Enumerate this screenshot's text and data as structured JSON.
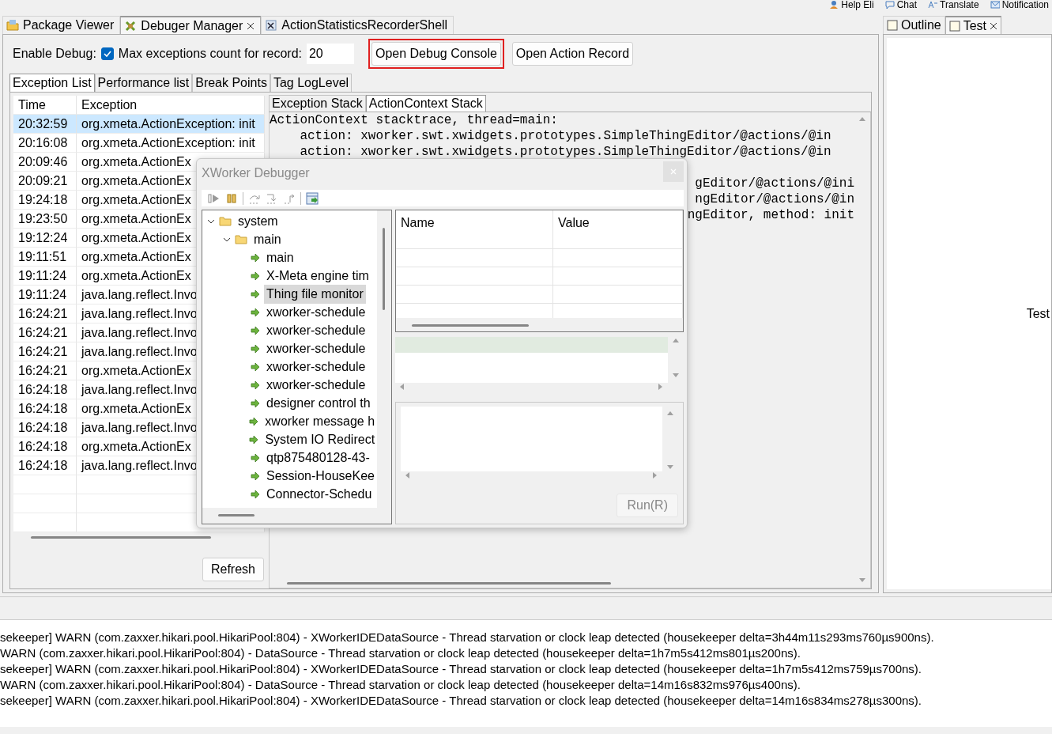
{
  "top_toolbar": [
    {
      "label": "Help Eli"
    },
    {
      "label": "Chat"
    },
    {
      "label": "Translate"
    },
    {
      "label": "Notification"
    }
  ],
  "editor_tabs": [
    {
      "label": "Package Viewer",
      "selected": false,
      "closable": false
    },
    {
      "label": "Debuger Manager",
      "selected": true,
      "closable": true
    },
    {
      "label": "ActionStatisticsRecorderShell",
      "selected": false,
      "closable": false
    }
  ],
  "toolbar": {
    "enable_label": "Enable Debug:",
    "enable_debug": true,
    "max_label": "Max exceptions count for record:",
    "max_value": "20",
    "buttons": [
      {
        "label": "Open Debug Console",
        "highlighted": true
      },
      {
        "label": "Open Action Record",
        "highlighted": false
      }
    ]
  },
  "sub_tabs": [
    {
      "label": "Exception List",
      "selected": true
    },
    {
      "label": "Performance list",
      "selected": false
    },
    {
      "label": "Break Points",
      "selected": false
    },
    {
      "label": "Tag LogLevel",
      "selected": false
    }
  ],
  "exception_table": {
    "columns": [
      "Time",
      "Exception"
    ],
    "rows": [
      {
        "time": "20:32:59",
        "exception": "org.xmeta.ActionException: init",
        "selected": true
      },
      {
        "time": "20:16:08",
        "exception": "org.xmeta.ActionException: init",
        "selected": false
      },
      {
        "time": "20:09:46",
        "exception": "org.xmeta.ActionEx",
        "selected": false
      },
      {
        "time": "20:09:21",
        "exception": "org.xmeta.ActionEx",
        "selected": false
      },
      {
        "time": "19:24:18",
        "exception": "org.xmeta.ActionEx",
        "selected": false
      },
      {
        "time": "19:23:50",
        "exception": "org.xmeta.ActionEx",
        "selected": false
      },
      {
        "time": "19:12:24",
        "exception": "org.xmeta.ActionEx",
        "selected": false
      },
      {
        "time": "19:11:51",
        "exception": "org.xmeta.ActionEx",
        "selected": false
      },
      {
        "time": "19:11:24",
        "exception": "org.xmeta.ActionEx",
        "selected": false
      },
      {
        "time": "19:11:24",
        "exception": "java.lang.reflect.Invo",
        "selected": false
      },
      {
        "time": "16:24:21",
        "exception": "java.lang.reflect.Invo",
        "selected": false
      },
      {
        "time": "16:24:21",
        "exception": "java.lang.reflect.Invo",
        "selected": false
      },
      {
        "time": "16:24:21",
        "exception": "java.lang.reflect.Invo",
        "selected": false
      },
      {
        "time": "16:24:21",
        "exception": "org.xmeta.ActionEx",
        "selected": false
      },
      {
        "time": "16:24:18",
        "exception": "java.lang.reflect.Invo",
        "selected": false
      },
      {
        "time": "16:24:18",
        "exception": "org.xmeta.ActionEx",
        "selected": false
      },
      {
        "time": "16:24:18",
        "exception": "java.lang.reflect.Invo",
        "selected": false
      },
      {
        "time": "16:24:18",
        "exception": "org.xmeta.ActionEx",
        "selected": false
      },
      {
        "time": "16:24:18",
        "exception": "java.lang.reflect.Invo",
        "selected": false
      }
    ]
  },
  "refresh_button": "Refresh",
  "stack_tabs": [
    {
      "label": "Exception Stack",
      "selected": false
    },
    {
      "label": "ActionContext Stack",
      "selected": true
    }
  ],
  "stack_lines": [
    {
      "kind": "line",
      "text": "ActionContext stacktrace, thread=main:"
    },
    {
      "kind": "line",
      "text": "    action: xworker.swt.xwidgets.prototypes.SimpleThingEditor/@actions/@in"
    },
    {
      "kind": "line",
      "text": "    action: xworker.swt.xwidgets.prototypes.SimpleThingEditor/@actions/@in"
    },
    {
      "kind": "gap"
    },
    {
      "kind": "tail",
      "text": "gEditor/@actions/@ini"
    },
    {
      "kind": "tail",
      "text": "ngEditor/@actions/@in"
    },
    {
      "kind": "tail",
      "text": "ngEditor, method: init"
    }
  ],
  "debugger_dialog": {
    "title": "XWorker Debugger",
    "active": false,
    "tree": [
      {
        "label": "system",
        "expanded": true,
        "children": [
          {
            "label": "main",
            "expanded": true,
            "children": [
              {
                "label": "main",
                "selected": false
              },
              {
                "label": "X-Meta engine tim",
                "selected": false
              },
              {
                "label": "Thing file monitor",
                "selected": true
              },
              {
                "label": "xworker-schedule",
                "selected": false
              },
              {
                "label": "xworker-schedule",
                "selected": false
              },
              {
                "label": "xworker-schedule",
                "selected": false
              },
              {
                "label": "xworker-schedule",
                "selected": false
              },
              {
                "label": "xworker-schedule",
                "selected": false
              },
              {
                "label": "designer control th",
                "selected": false
              },
              {
                "label": "xworker message h",
                "selected": false
              },
              {
                "label": "System IO Redirect",
                "selected": false
              },
              {
                "label": "qtp875480128-43-",
                "selected": false
              },
              {
                "label": "Session-HouseKee",
                "selected": false
              },
              {
                "label": "Connector-Schedu",
                "selected": false
              }
            ]
          }
        ]
      }
    ],
    "variables": {
      "columns": [
        "Name",
        "Value"
      ]
    },
    "run_button": {
      "label": "Run(R)",
      "disabled": true
    }
  },
  "side_tabs": [
    {
      "label": "Outline",
      "selected": false
    },
    {
      "label": "Test",
      "selected": true
    }
  ],
  "side_content": "Test",
  "console_lines": [
    "sekeeper]  WARN (com.zaxxer.hikari.pool.HikariPool:804) - XWorkerIDEDataSource - Thread starvation or clock leap detected (housekeeper delta=3h44m11s293ms760µs900ns).",
    "WARN (com.zaxxer.hikari.pool.HikariPool:804) - DataSource - Thread starvation or clock leap detected (housekeeper delta=1h7m5s412ms801µs200ns).",
    "sekeeper]  WARN (com.zaxxer.hikari.pool.HikariPool:804) - XWorkerIDEDataSource - Thread starvation or clock leap detected (housekeeper delta=1h7m5s412ms759µs700ns).",
    "WARN (com.zaxxer.hikari.pool.HikariPool:804) - DataSource - Thread starvation or clock leap detected (housekeeper delta=14m16s832ms976µs400ns).",
    "sekeeper]  WARN (com.zaxxer.hikari.pool.HikariPool:804) - XWorkerIDEDataSource - Thread starvation or clock leap detected (housekeeper delta=14m16s834ms278µs300ns)."
  ]
}
